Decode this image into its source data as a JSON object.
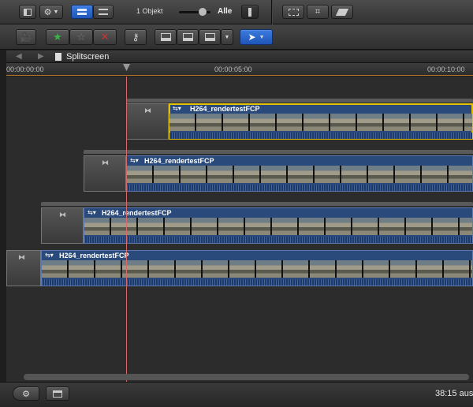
{
  "toolbar": {
    "clip_count": "1 Objekt",
    "zoom_scope": "Alle"
  },
  "timeline": {
    "project_name": "Splitscreen",
    "ruler_ticks": [
      "00:00:00:00",
      "00:00:05:00",
      "00:00:10:00"
    ]
  },
  "clips": [
    {
      "name": "H264_rendertestFCP"
    },
    {
      "name": "H264_rendertestFCP"
    },
    {
      "name": "H264_rendertestFCP"
    },
    {
      "name": "H264_rendertestFCP"
    }
  ],
  "status": {
    "duration": "38:15 aus"
  },
  "colors": {
    "accent_blue": "#2a65d0",
    "selection_yellow": "#e4c200",
    "playhead": "#d86a6a",
    "clip_blue": "#2a4a7c"
  }
}
